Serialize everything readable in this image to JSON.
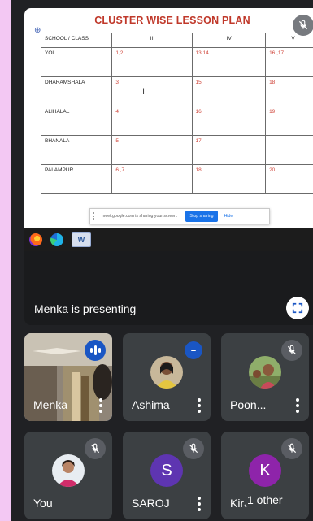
{
  "slide": {
    "title": "CLUSTER WISE LESSON PLAN",
    "headers": [
      "SCHOOL / CLASS",
      "III",
      "IV",
      "V"
    ],
    "rows": [
      {
        "school": "YOL",
        "iii": "1,2",
        "iv": "13,14",
        "v": "16 ,17"
      },
      {
        "school": "DHARAMSHALA",
        "iii": "3",
        "iv": "15",
        "v": "18"
      },
      {
        "school": "ALIHALAL",
        "iii": "4",
        "iv": "16",
        "v": "19"
      },
      {
        "school": "BHANALA",
        "iii": "5",
        "iv": "17",
        "v": ""
      },
      {
        "school": "PALAMPUR",
        "iii": "6 ,7",
        "iv": "18",
        "v": "20"
      }
    ],
    "share_bar": {
      "message": "meet.google.com is sharing your screen.",
      "stop_label": "Stop sharing",
      "hide_label": "Hide"
    }
  },
  "presentation": {
    "label": "Menka is presenting"
  },
  "participants": [
    {
      "name": "Menka",
      "status": "speaking"
    },
    {
      "name": "Ashima",
      "status": "quiet"
    },
    {
      "name": "Poon...",
      "status": "muted"
    },
    {
      "name": "You",
      "status": "muted"
    },
    {
      "name": "SAROJ",
      "status": "muted",
      "initial": "S",
      "color": "#5e35b1"
    },
    {
      "name": "Kiran",
      "status": "muted",
      "initial": "K",
      "color": "#8e24aa"
    }
  ],
  "overflow": {
    "label": "1 other"
  },
  "colors": {
    "meet_bg": "#202124",
    "tile_bg": "#3c4043",
    "accent": "#1a73e8",
    "active_border": "#8ab4f8",
    "slide_title": "#c0392b"
  },
  "icons": [
    "mic-off-icon",
    "fullscreen-icon",
    "more-vert-icon",
    "speaking-indicator-icon",
    "firefox-icon",
    "edge-icon",
    "word-icon"
  ]
}
